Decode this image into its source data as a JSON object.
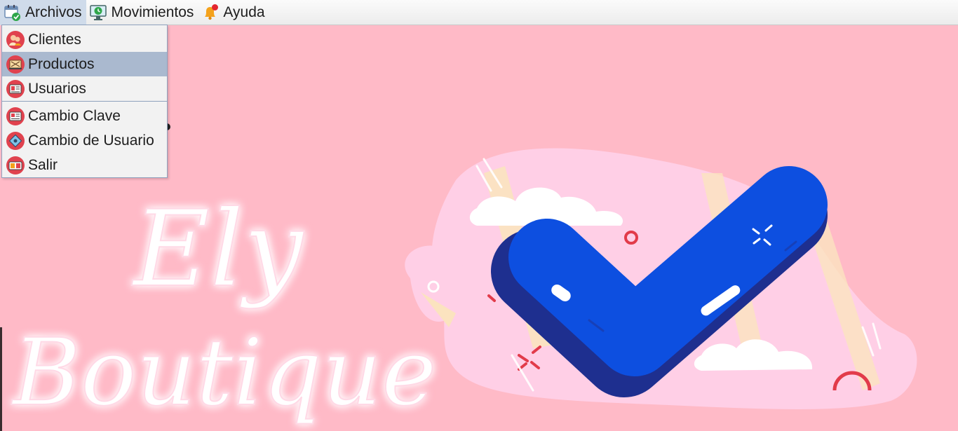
{
  "menubar": {
    "items": [
      {
        "label": "Archivos",
        "icon": "calendar-check-icon"
      },
      {
        "label": "Movimientos",
        "icon": "monitor-clock-icon"
      },
      {
        "label": "Ayuda",
        "icon": "bell-icon"
      }
    ]
  },
  "dropdown": {
    "items": [
      {
        "label": "Clientes",
        "icon": "clients-icon"
      },
      {
        "label": "Productos",
        "icon": "products-icon"
      },
      {
        "label": "Usuarios",
        "icon": "users-icon"
      },
      {
        "label": "Cambio Clave",
        "icon": "key-card-icon"
      },
      {
        "label": "Cambio de Usuario",
        "icon": "switch-user-icon"
      },
      {
        "label": "Salir",
        "icon": "exit-icon"
      }
    ],
    "hovered_item": "Productos"
  },
  "background": {
    "logo_text_line1": "Ely",
    "logo_text_line2": "Boutique",
    "colors": {
      "background": "#ffbac7",
      "check": "#0d4fe0",
      "check_shadow": "#1e2f8f",
      "blob": "#ffcfe6",
      "stripes": "#fbe3bf"
    }
  }
}
